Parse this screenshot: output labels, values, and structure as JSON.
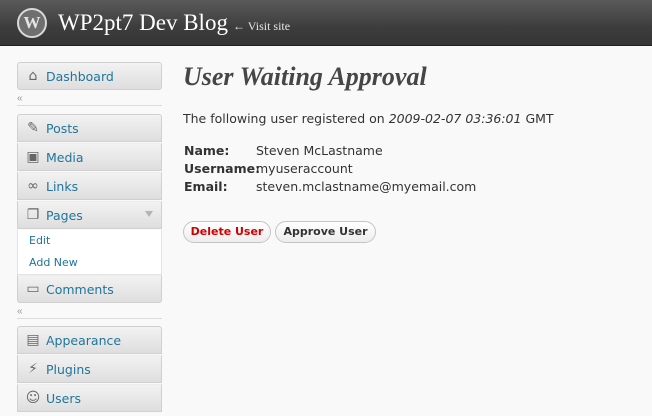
{
  "header": {
    "logo_letter": "W",
    "site_title": "WP2pt7 Dev Blog",
    "visit_site": "← Visit site"
  },
  "sidebar": {
    "collapse_glyph": "«",
    "dashboard": {
      "label": "Dashboard",
      "icon": "home-icon"
    },
    "posts": {
      "label": "Posts",
      "icon": "pushpin-icon"
    },
    "media": {
      "label": "Media",
      "icon": "camera-icon"
    },
    "links": {
      "label": "Links",
      "icon": "chain-link-icon"
    },
    "pages": {
      "label": "Pages",
      "icon": "pages-icon"
    },
    "pages_submenu": [
      {
        "label": "Edit"
      },
      {
        "label": "Add New"
      }
    ],
    "comments": {
      "label": "Comments",
      "icon": "speech-bubble-icon"
    },
    "appearance": {
      "label": "Appearance",
      "icon": "appearance-icon"
    },
    "plugins": {
      "label": "Plugins",
      "icon": "plug-icon"
    },
    "users": {
      "label": "Users",
      "icon": "users-icon"
    }
  },
  "main": {
    "title": "User Waiting Approval",
    "intro_prefix": "The following user registered on ",
    "registered_date": "2009-02-07 03:36:01",
    "intro_suffix": " GMT",
    "details": [
      {
        "label": "Name:",
        "value": "Steven McLastname"
      },
      {
        "label": "Username:",
        "value": "myuseraccount"
      },
      {
        "label": "Email:",
        "value": "steven.mclastname@myemail.com"
      }
    ],
    "delete_button": "Delete User",
    "approve_button": "Approve User"
  },
  "colors": {
    "link": "#21759b",
    "delete": "#d00000",
    "header_bg": "#464646"
  }
}
